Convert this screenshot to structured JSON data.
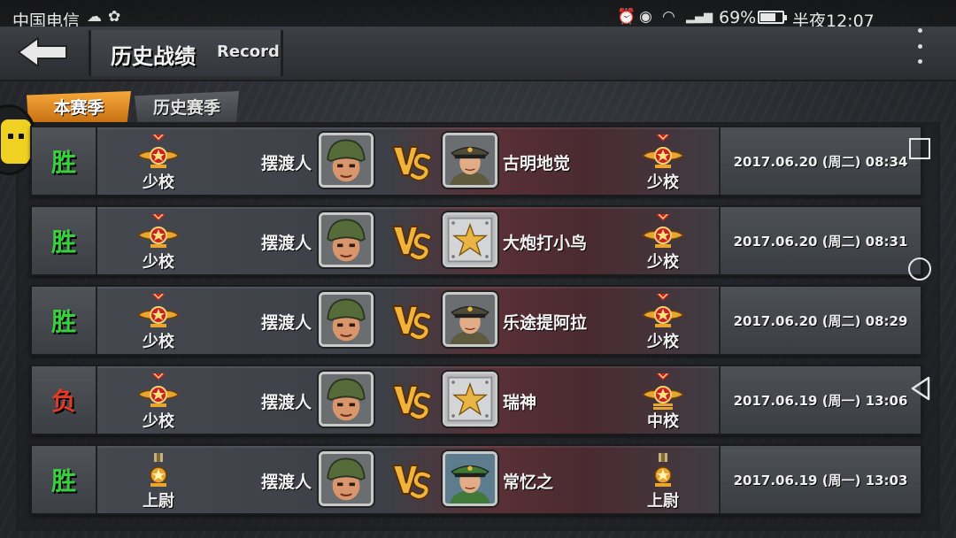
{
  "status_bar": {
    "carrier": "中国电信",
    "battery_percent": "69%",
    "battery_level": 0.69,
    "time": "半夜12:07",
    "icons": [
      "weather-icon",
      "app-notification-icon",
      "alarm-icon",
      "eye-icon",
      "wifi-icon",
      "signal-icon"
    ]
  },
  "header": {
    "title_cn": "历史战绩",
    "title_en": "Record"
  },
  "tabs": [
    {
      "label": "本赛季",
      "active": true
    },
    {
      "label": "历史赛季",
      "active": false
    }
  ],
  "colors": {
    "win": "#37d13d",
    "loss": "#e23a26",
    "tab_active": "#e58a22"
  },
  "battles": [
    {
      "result": "胜",
      "outcome": "win",
      "player_rank": "少校",
      "player_name": "摆渡人",
      "player_avatar": "helmet-soldier",
      "opponent_rank": "少校",
      "opponent_name": "古明地觉",
      "opponent_avatar": "officer",
      "date": "2017.06.20 (周二) 08:34"
    },
    {
      "result": "胜",
      "outcome": "win",
      "player_rank": "少校",
      "player_name": "摆渡人",
      "player_avatar": "helmet-soldier",
      "opponent_rank": "少校",
      "opponent_name": "大炮打小鸟",
      "opponent_avatar": "star-plate",
      "date": "2017.06.20 (周二) 08:31"
    },
    {
      "result": "胜",
      "outcome": "win",
      "player_rank": "少校",
      "player_name": "摆渡人",
      "player_avatar": "helmet-soldier",
      "opponent_rank": "少校",
      "opponent_name": "乐途提阿拉",
      "opponent_avatar": "officer",
      "date": "2017.06.20 (周二) 08:29"
    },
    {
      "result": "负",
      "outcome": "loss",
      "player_rank": "少校",
      "player_name": "摆渡人",
      "player_avatar": "helmet-soldier",
      "opponent_rank": "中校",
      "opponent_name": "瑞神",
      "opponent_avatar": "star-plate",
      "date": "2017.06.19 (周一) 13:06"
    },
    {
      "result": "胜",
      "outcome": "win",
      "player_rank": "上尉",
      "player_name": "摆渡人",
      "player_avatar": "helmet-soldier",
      "opponent_rank": "上尉",
      "opponent_name": "常忆之",
      "opponent_avatar": "green-officer",
      "date": "2017.06.19 (周一) 13:03"
    }
  ]
}
